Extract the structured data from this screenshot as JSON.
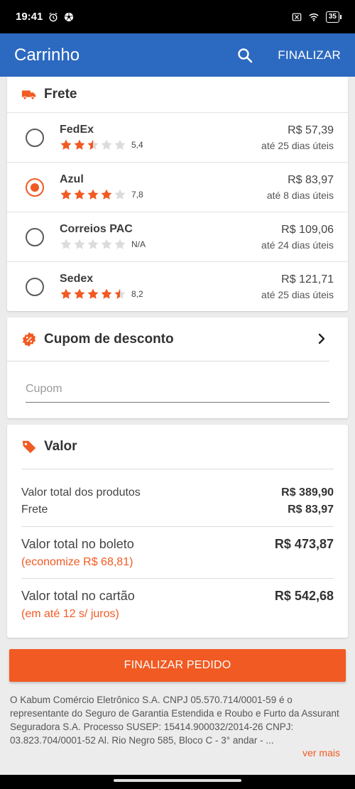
{
  "status_bar": {
    "time": "19:41",
    "battery": "35"
  },
  "app_bar": {
    "title": "Carrinho",
    "action": "FINALIZAR"
  },
  "colors": {
    "brand_blue": "#2c69c0",
    "accent_orange": "#f15a22"
  },
  "frete": {
    "title": "Frete",
    "options": [
      {
        "name": "FedEx",
        "rating": 2.5,
        "rating_text": "5,4",
        "price": "R$ 57,39",
        "days": "até 25 dias úteis",
        "selected": false
      },
      {
        "name": "Azul",
        "rating": 4,
        "rating_text": "7,8",
        "price": "R$ 83,97",
        "days": "até 8 dias úteis",
        "selected": true
      },
      {
        "name": "Correios PAC",
        "rating": 0,
        "rating_text": "N/A",
        "price": "R$ 109,06",
        "days": "até 24 dias úteis",
        "selected": false
      },
      {
        "name": "Sedex",
        "rating": 4.5,
        "rating_text": "8,2",
        "price": "R$ 121,71",
        "days": "até 25 dias úteis",
        "selected": false
      }
    ]
  },
  "cupom": {
    "title": "Cupom de desconto",
    "placeholder": "Cupom",
    "value": ""
  },
  "valor": {
    "title": "Valor",
    "produtos_label": "Valor total dos produtos",
    "produtos_value": "R$ 389,90",
    "frete_label": "Frete",
    "frete_value": "R$ 83,97",
    "boleto_label": "Valor total no boleto",
    "boleto_value": "R$ 473,87",
    "boleto_sub": "(economize R$ 68,81)",
    "cartao_label": "Valor total no cartão",
    "cartao_value": "R$ 542,68",
    "cartao_sub": "(em até 12 s/ juros)"
  },
  "finalizar_button": "FINALIZAR PEDIDO",
  "legal": {
    "text": "O Kabum Comércio Eletrônico S.A. CNPJ 05.570.714/0001-59 é o representante do Seguro de Garantia Estendida e Roubo e Furto da Assurant Seguradora S.A. Processo SUSEP: 15414.900032/2014-26 CNPJ: 03.823.704/0001-52 Al. Rio Negro 585, Bloco C - 3° andar - ...",
    "ver_mais": "ver mais"
  }
}
